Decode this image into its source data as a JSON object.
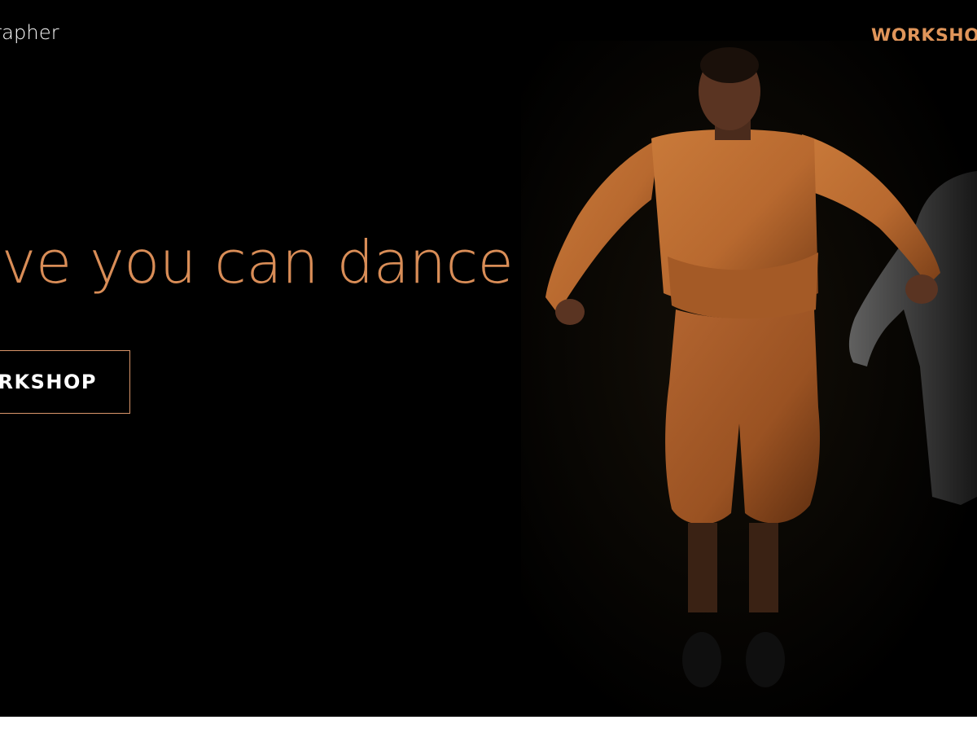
{
  "header": {
    "brand_text": "rapher",
    "nav_link_label": "WORKSHO"
  },
  "hero": {
    "headline": "eve you can dance.",
    "cta_label": "RKSHOP",
    "photo": {
      "subject": "dancer-in-orange-costume-mid-jump",
      "colors": {
        "costume": "#b8692f",
        "costume_shadow": "#7a3f18",
        "skin": "#5a3422",
        "background": "#000000"
      }
    }
  },
  "colors": {
    "accent": "#e0955a",
    "headline": "#d98d57",
    "text": "#ffffff",
    "background": "#000000"
  }
}
